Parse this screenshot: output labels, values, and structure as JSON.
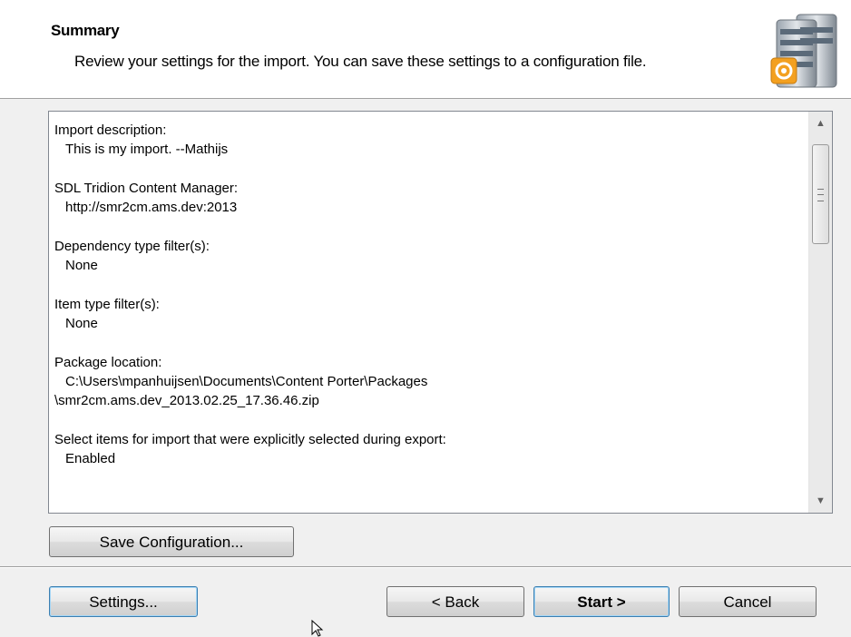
{
  "header": {
    "title": "Summary",
    "subtitle": "Review your settings for the import. You can save these settings to a configuration file.",
    "icon": "server-database-icon"
  },
  "summary": {
    "sections": [
      {
        "label": "Import description:",
        "value": "This is my import. --Mathijs"
      },
      {
        "label": "SDL Tridion Content Manager:",
        "value": "http://smr2cm.ams.dev:2013"
      },
      {
        "label": "Dependency type filter(s):",
        "value": "None"
      },
      {
        "label": "Item type filter(s):",
        "value": "None"
      },
      {
        "label": "Package location:",
        "value": "C:\\Users\\mpanhuijsen\\Documents\\Content Porter\\Packages",
        "value_cont": "\\smr2cm.ams.dev_2013.02.25_17.36.46.zip"
      },
      {
        "label": "Select items for import that were explicitly selected during export:",
        "value": "Enabled"
      }
    ]
  },
  "buttons": {
    "save_configuration": "Save Configuration...",
    "settings": "Settings...",
    "back": "< Back",
    "start": "Start >",
    "cancel": "Cancel"
  }
}
